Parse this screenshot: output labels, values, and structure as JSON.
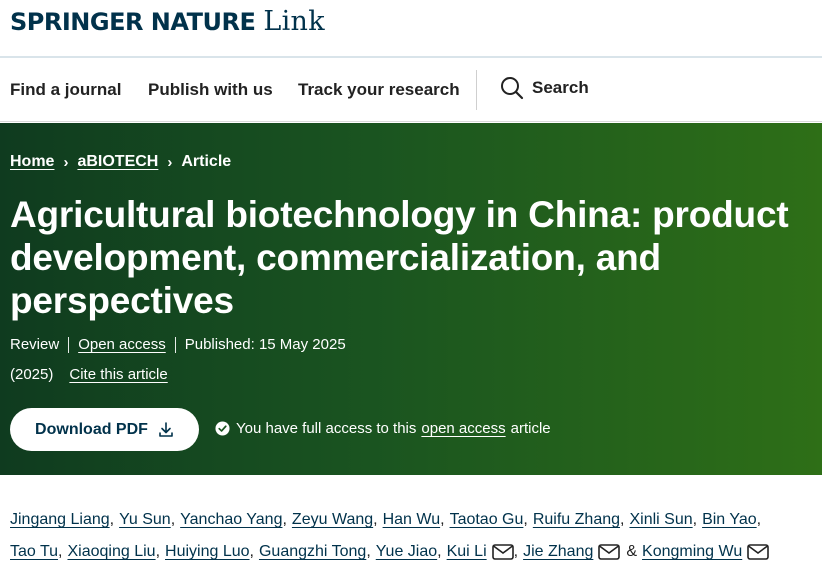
{
  "brand": {
    "name": "SPRINGER NATURE",
    "suffix": "Link",
    "color": "#01324b"
  },
  "nav": {
    "items": [
      "Find a journal",
      "Publish with us",
      "Track your research"
    ],
    "search_label": "Search",
    "search_icon": "magnifier"
  },
  "hero": {
    "background": "#1a5420",
    "breadcrumb": [
      {
        "label": "Home"
      },
      {
        "label": "aBIOTECH"
      },
      {
        "label": "Article"
      }
    ],
    "title_lines": [
      "Agricultural biotechnology in China: product",
      "development, commercialization, and",
      "perspectives"
    ],
    "meta": {
      "type": "Review",
      "access": "Open access",
      "published": "Published: 15 May 2025",
      "year": "(2025)",
      "cite": "Cite this article"
    },
    "download": {
      "label": "Download PDF",
      "icon": "download-arrow"
    },
    "access_note": {
      "before": "You have full access to this",
      "link": "open access",
      "after": "article"
    }
  },
  "authors": {
    "line1": [
      "Jingang Liang",
      "Yu Sun",
      "Yanchao Yang",
      "Zeyu Wang",
      "Han Wu",
      "Taotao Gu",
      "Ruifu Zhang",
      "Xinli Sun",
      "Bin Yao"
    ],
    "line2": [
      "Tao Tu",
      "Xiaoqing Liu",
      "Huiying Luo",
      "Guangzhi Tong",
      "Yue Jiao",
      "Kui Li",
      "Jie Zhang",
      "Kongming Wu"
    ],
    "amp": "&",
    "mail_icon": "envelope"
  }
}
